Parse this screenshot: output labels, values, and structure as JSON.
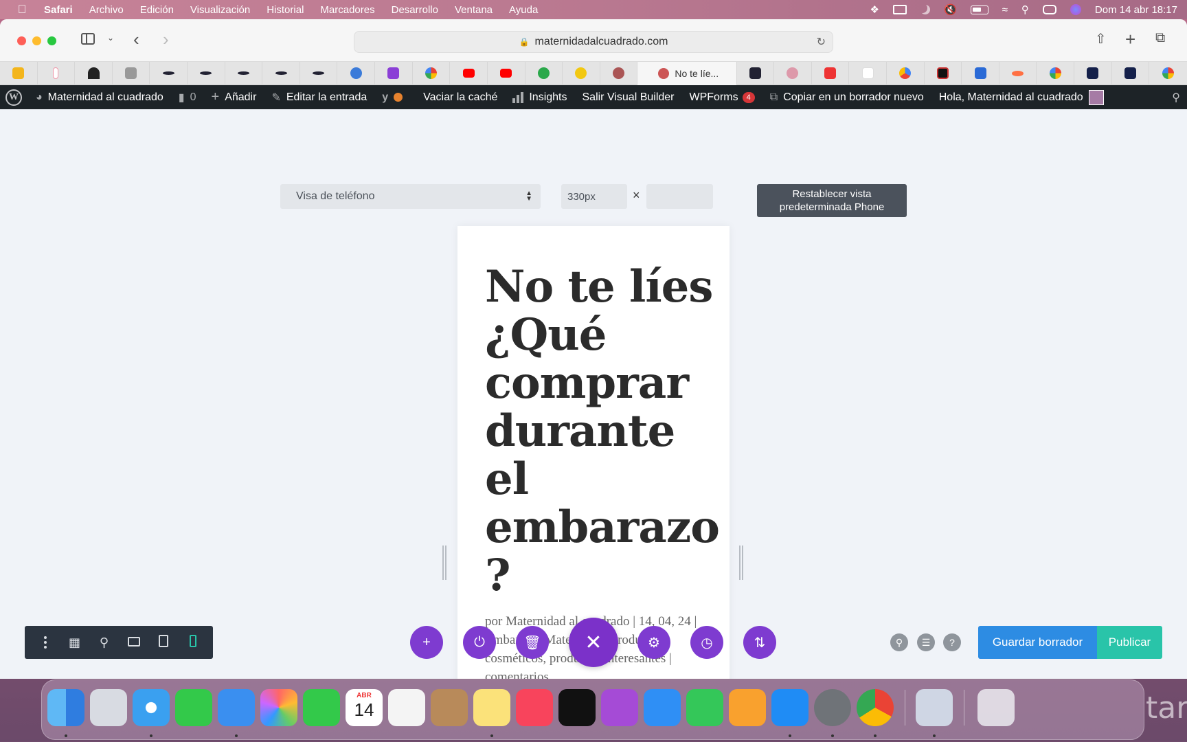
{
  "menubar": {
    "app": "Safari",
    "items": [
      "Archivo",
      "Edición",
      "Visualización",
      "Historial",
      "Marcadores",
      "Desarrollo",
      "Ventana",
      "Ayuda"
    ],
    "datetime": "Dom 14 abr 18:17"
  },
  "browser": {
    "url": "maternidadalcuadrado.com",
    "active_tab_title": "No te líe..."
  },
  "adminbar": {
    "site_name": "Maternidad al cuadrado",
    "comments_count": "0",
    "add_new": "Añadir",
    "edit_post": "Editar la entrada",
    "clear_cache": "Vaciar la caché",
    "insights": "Insights",
    "exit_builder": "Salir Visual Builder",
    "wpforms": "WPForms",
    "wpforms_count": "4",
    "copy_draft": "Copiar en un borrador nuevo",
    "greeting": "Hola, Maternidad al cuadrado"
  },
  "builder": {
    "view_select": "Visa de teléfono",
    "width_value": "330px",
    "times_symbol": "×",
    "reset_button": "Restablecer vista predeterminada Phone",
    "save_draft": "Guardar borrador",
    "publish": "Publicar"
  },
  "post": {
    "title": "No te líes ¿Qué comprar durante el embarazo ?",
    "meta": "por Maternidad al cuadrado | 14, 04, 24 | Embarazo, Maternidad, productos cosméticos, productos interesantes | comentarios"
  },
  "dock": {
    "calendar_month": "ABR",
    "calendar_day": "14",
    "trailing_text": "tar"
  },
  "colors": {
    "builder_purple": "#7e3bd0",
    "save_blue": "#2d8ce3",
    "publish_teal": "#29c4a9",
    "adminbar_bg": "#1d2327"
  }
}
